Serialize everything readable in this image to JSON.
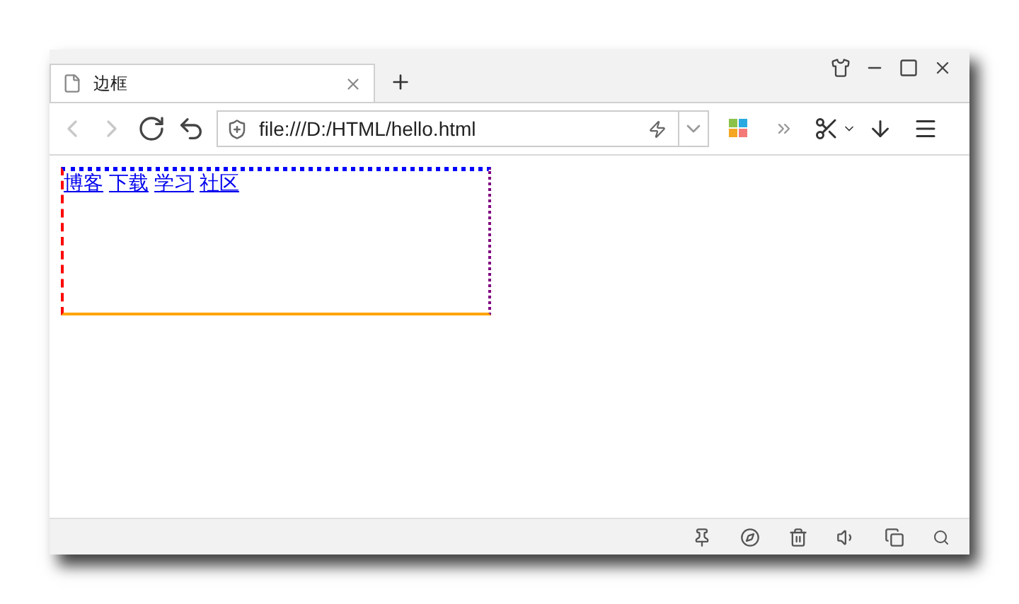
{
  "tabs": [
    {
      "title": "边框",
      "selected": true
    }
  ],
  "nav": [
    {
      "kind": "back",
      "disabled": true
    },
    {
      "kind": "forward",
      "disabled": true
    },
    {
      "kind": "reload",
      "disabled": false
    },
    {
      "kind": "undo",
      "disabled": false
    }
  ],
  "address": {
    "url": "file:///D:/HTML/hello.html"
  },
  "links": [
    "博客",
    "下载",
    "学习",
    "社区"
  ]
}
